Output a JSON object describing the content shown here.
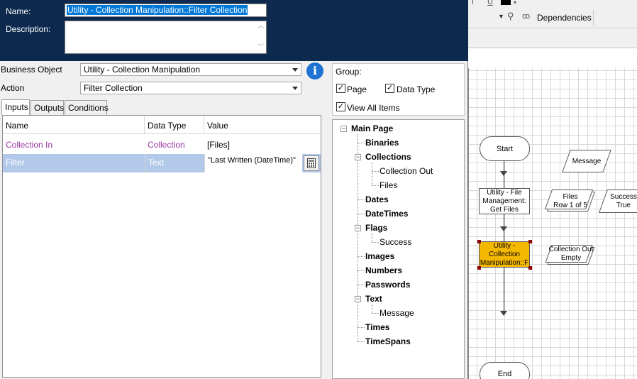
{
  "header": {
    "name_label": "Name:",
    "name_value": "Utility - Collection Manipulation::Filter Collection",
    "description_label": "Description:",
    "description_value": ""
  },
  "form": {
    "business_object_label": "Business Object",
    "business_object_value": "Utility - Collection Manipulation",
    "action_label": "Action",
    "action_value": "Filter Collection"
  },
  "tabs": [
    "Inputs",
    "Outputs",
    "Conditions"
  ],
  "inputs_table": {
    "columns": [
      "Name",
      "Data Type",
      "Value"
    ],
    "rows": [
      {
        "name": "Collection In",
        "data_type": "Collection",
        "value": "[Files]"
      },
      {
        "name": "Filter",
        "data_type": "Text",
        "value": "\"Last Written (DateTime)\""
      }
    ]
  },
  "group": {
    "label": "Group:",
    "page": "Page",
    "data_type": "Data Type",
    "view_all": "View All Items"
  },
  "tree": {
    "root": "Main Page",
    "binaries": "Binaries",
    "collections": "Collections",
    "collection_out": "Collection Out",
    "files": "Files",
    "dates": "Dates",
    "datetimes": "DateTimes",
    "flags": "Flags",
    "success": "Success",
    "images": "Images",
    "numbers": "Numbers",
    "passwords": "Passwords",
    "text": "Text",
    "message": "Message",
    "times": "Times",
    "timespans": "TimeSpans"
  },
  "toolbar": {
    "dependencies": "Dependencies"
  },
  "flowchart": {
    "start": "Start",
    "end": "End",
    "message": "Message",
    "get_files": "Utility - File Management: Get Files",
    "files_label": "Files",
    "files_row": "Row 1 of 5",
    "success_label": "Success",
    "success_value": "True",
    "filter_stage": "Utility - Collection Manipulation::F",
    "collection_out_label": "Collection Out",
    "collection_out_value": "Empty"
  },
  "colors": {
    "header_bg": "#0d2a4e",
    "selection": "#0078d7",
    "row_selected": "#b3c9e9",
    "collection_text": "#9a36a2",
    "selected_stage": "#f5b800"
  }
}
